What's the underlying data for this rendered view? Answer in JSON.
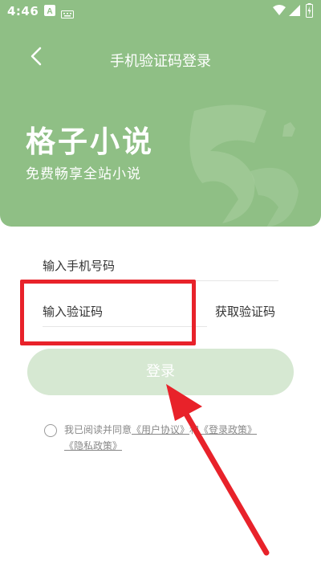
{
  "status_bar": {
    "time": "4:46",
    "left_icons": [
      "app-icon-a",
      "keyboard-icon"
    ],
    "right_icons": [
      "wifi-icon",
      "signal-icon",
      "battery-icon"
    ]
  },
  "nav": {
    "title": "手机验证码登录",
    "back_icon": "chevron-left-icon"
  },
  "banner": {
    "app_name": "格子小说",
    "slogan": "免费畅享全站小说"
  },
  "form": {
    "phone_placeholder": "输入手机号码",
    "code_placeholder": "输入验证码",
    "get_code_label": "获取验证码",
    "login_label": "登录"
  },
  "agreement": {
    "prefix": "我已阅读并同意",
    "user_agreement": "《用户协议》",
    "and": "和",
    "login_policy": "《登录政策》",
    "privacy_policy": "《隐私政策》"
  },
  "colors": {
    "brand_green": "#8fbf85",
    "button_disabled": "#d6e8d2",
    "annotation_red": "#e8222a"
  }
}
